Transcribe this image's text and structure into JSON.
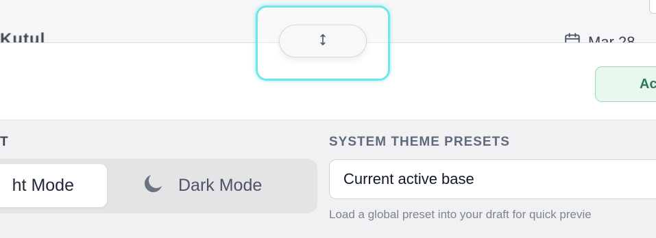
{
  "background": {
    "title_fragment": "Kutul",
    "date_fragment": "Mar 28"
  },
  "header": {
    "action_button": "Ac"
  },
  "appearance": {
    "section_label": "T",
    "light_mode": "ht Mode",
    "dark_mode": "Dark Mode"
  },
  "presets": {
    "section_label": "SYSTEM THEME PRESETS",
    "selected": "Current active base",
    "help": "Load a global preset into your draft for quick previe"
  },
  "handle": {
    "icon": "vertical-resize-icon",
    "highlight_color": "#6ee7ea"
  },
  "colors": {
    "accent_green": "#2d7a52",
    "accent_green_bg": "#e9f8ef",
    "label_gray": "#5f6b7c"
  }
}
